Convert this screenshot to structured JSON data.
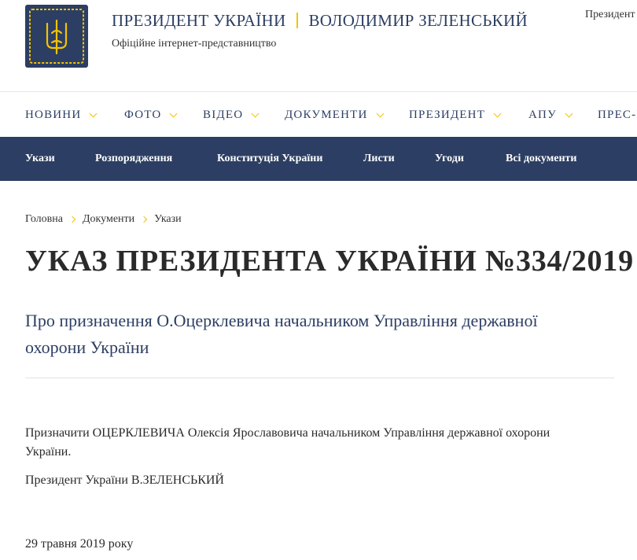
{
  "header": {
    "title_left": "ПРЕЗИДЕНТ УКРАЇНИ",
    "title_right": "ВОЛОДИМИР ЗЕЛЕНСЬКИЙ",
    "subtitle": "Офіційне інтернет-представництво",
    "top_right_link": "Президент"
  },
  "main_nav": {
    "items": [
      {
        "label": "НОВИНИ"
      },
      {
        "label": "ФОТО"
      },
      {
        "label": "ВІДЕО"
      },
      {
        "label": "ДОКУМЕНТИ"
      },
      {
        "label": "ПРЕЗИДЕНТ"
      },
      {
        "label": "АПУ"
      },
      {
        "label": "ПРЕС-Ц"
      }
    ]
  },
  "sub_nav": {
    "items": [
      {
        "label": "Укази"
      },
      {
        "label": "Розпорядження"
      },
      {
        "label": "Конституція України"
      },
      {
        "label": "Листи"
      },
      {
        "label": "Угоди"
      },
      {
        "label": "Всі документи"
      }
    ]
  },
  "breadcrumb": {
    "items": [
      "Головна",
      "Документи",
      "Укази"
    ]
  },
  "document": {
    "title": "УКАЗ ПРЕЗИДЕНТА УКРАЇНИ №334/2019",
    "subtitle": "Про призначення О.Оцерклевича начальником Управління державної охорони України",
    "body_paragraph": "Призначити ОЦЕРКЛЕВИЧА Олексія Ярославовича начальником Управління державної охорони України.",
    "signature": "Президент України В.ЗЕЛЕНСЬКИЙ",
    "date": "29 травня 2019 року"
  },
  "colors": {
    "navy": "#2c3e63",
    "accent_yellow": "#f2c300",
    "text": "#2a2a2a"
  },
  "icons": {
    "logo": "trident-coat-of-arms-icon",
    "nav_chevron": "chevron-down-icon",
    "breadcrumb_separator": "chevron-right-icon"
  }
}
